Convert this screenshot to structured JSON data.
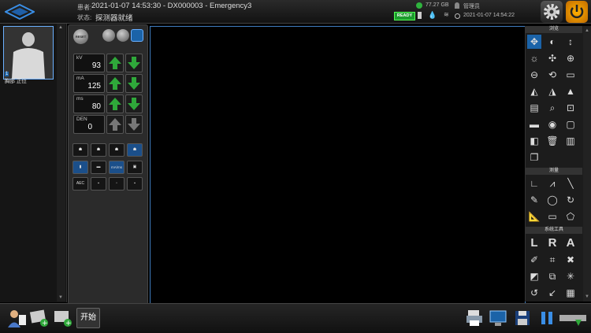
{
  "header": {
    "patient_label": "患者:",
    "patient_info": "2021-01-07 14:53:30 - DX000003 - Emergency3",
    "status_label": "状态:",
    "status_value": "探测器就绪",
    "ready_badge": "READY",
    "disk_free": "77.27 GB",
    "user": "管理员",
    "datetime": "2021-01-07 14:54:22"
  },
  "thumbnail": {
    "index": "1",
    "label": "胸部 正位"
  },
  "controls": {
    "reset_label": "RESET",
    "kv": {
      "label": "kV",
      "value": "93"
    },
    "ma": {
      "label": "mA",
      "value": "125"
    },
    "ms": {
      "label": "ms",
      "value": "80"
    },
    "den": {
      "label": "DEN",
      "value": "0"
    },
    "mode_label": "mA/ms",
    "aec_label": "AEC"
  },
  "tools": {
    "section_view": "浏览",
    "section_measure": "测量",
    "section_system": "系统工具",
    "letter_l": "L",
    "letter_r": "R",
    "letter_a": "A"
  },
  "bottom": {
    "start_label": "开始"
  },
  "colors": {
    "accent": "#3f7dbf",
    "ready": "#1c9b2d",
    "arrow_green": "#2fa83a",
    "power_orange": "#f0a000"
  }
}
